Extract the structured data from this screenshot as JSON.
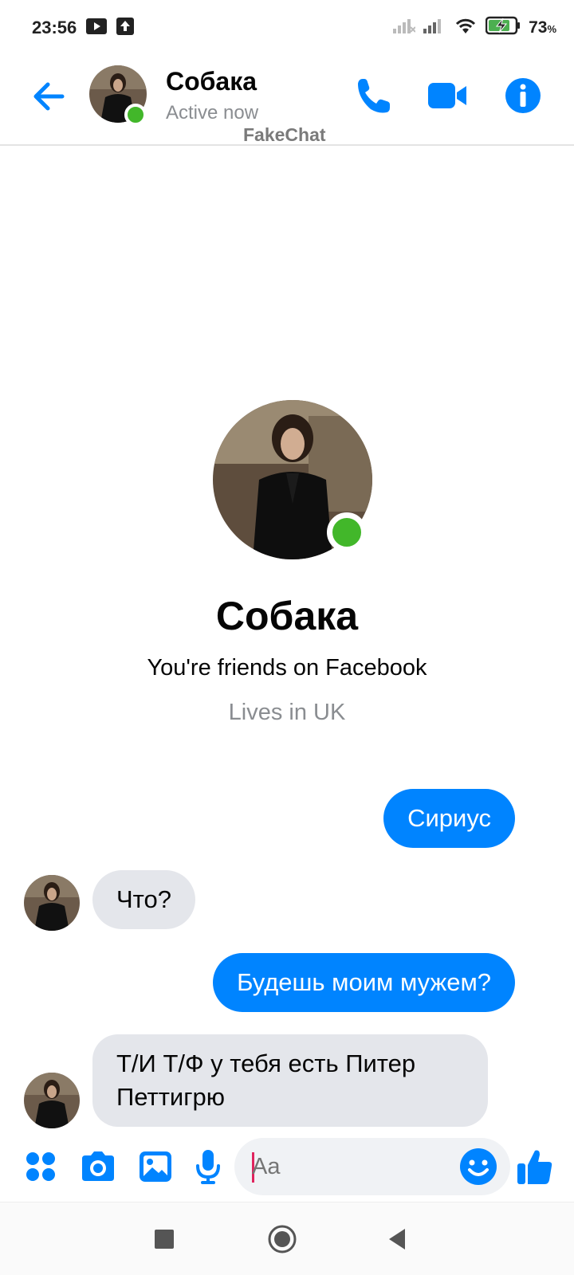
{
  "status_bar": {
    "time": "23:56",
    "battery_percent": "73",
    "battery_unit": "%",
    "icons": [
      "youtube-icon",
      "upload-icon",
      "signal-icon",
      "signal-icon",
      "wifi-icon",
      "battery-charging-icon"
    ]
  },
  "header": {
    "contact_name": "Собака",
    "presence": "Active now",
    "watermark": "FakeChat",
    "accent_color": "#0084ff",
    "online_color": "#42b72a"
  },
  "profile": {
    "name": "Собака",
    "friends_text": "You're friends on Facebook",
    "location_text": "Lives in UK"
  },
  "messages": [
    {
      "direction": "out",
      "text": "Сириус"
    },
    {
      "direction": "in",
      "text": "Что?"
    },
    {
      "direction": "out",
      "text": "Будешь моим мужем?"
    },
    {
      "direction": "in",
      "text": "Т/И Т/Ф у тебя есть Питер Петтигрю"
    }
  ],
  "composer": {
    "placeholder": "Aa"
  }
}
